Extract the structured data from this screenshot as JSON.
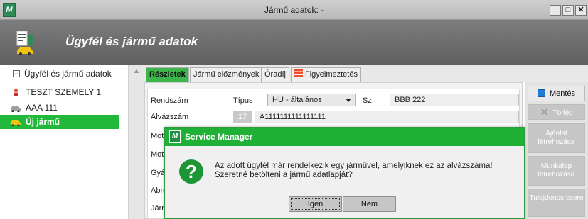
{
  "window": {
    "title": "Jármű adatok: -",
    "app_icon_letter": "M",
    "min_glyph": "_",
    "max_glyph": "□",
    "close_glyph": "✕"
  },
  "header": {
    "title": "Ügyfél és jármű adatok"
  },
  "tree": {
    "root": {
      "label": "Ügyfél és jármű adatok",
      "expander": "−"
    },
    "items": [
      {
        "label": "TESZT SZEMELY 1",
        "icon": "person-icon"
      },
      {
        "label": "AAA 111",
        "icon": "car-icon"
      },
      {
        "label": "Új jármű",
        "icon": "car-icon",
        "selected": true
      }
    ]
  },
  "tabs": [
    {
      "label": "Részletek",
      "active": true
    },
    {
      "label": "Jármű előzmények"
    },
    {
      "label": "Óradíj"
    },
    {
      "label": "Figyelmeztetés",
      "icon": "warning-flag-icon"
    }
  ],
  "form": {
    "rendszam_label": "Rendszám",
    "tipus_label": "Típus",
    "tipus_value": "HU - általános",
    "sz_label": "Sz.",
    "sz_value": "BBB 222",
    "alvazszam_label": "Alvázszám",
    "alvazszam_count": "17",
    "alvazszam_value": "A1111111111111111",
    "partial_labels": [
      "Mot",
      "Mot",
      "Gyá",
      "Abro",
      "Járr"
    ]
  },
  "actions": {
    "save": "Mentés",
    "delete": "Törlés",
    "create_quote": "Ajánlat létrehozása",
    "create_worksheet": "Munkalap létrehozása",
    "owner_change": "Tulajdonos csere"
  },
  "dialog": {
    "title": "Service Manager",
    "icon_letter": "M",
    "question_glyph": "?",
    "message_line1": "Az adott ügyfél már rendelkezik egy járművel, amelyiknek ez az alvázszáma!",
    "message_line2": "Szeretné betölteni a jármű adatlapját?",
    "yes": "Igen",
    "no": "Nem"
  },
  "colors": {
    "accent_green": "#1fb135",
    "header_gray": "#6e6e6e"
  }
}
